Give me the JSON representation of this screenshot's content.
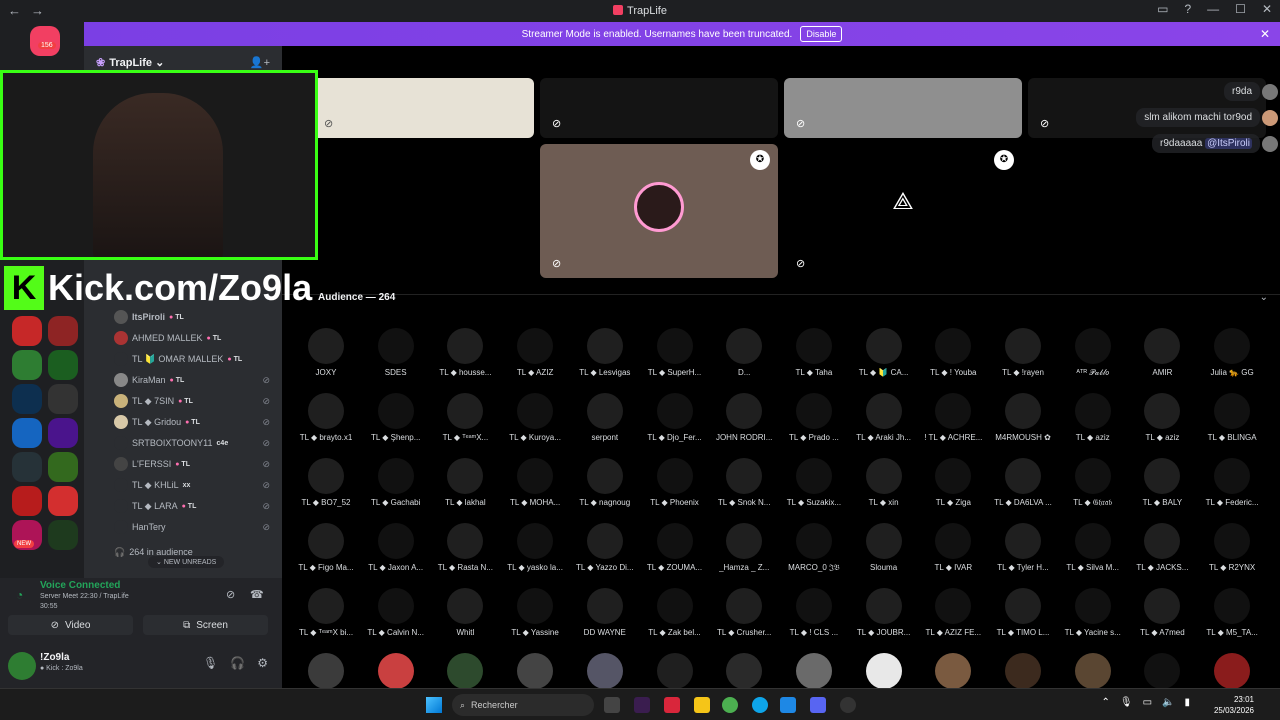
{
  "window": {
    "title": "TrapLife",
    "back_icon": "←",
    "forward_icon": "→",
    "controls": [
      "▭",
      "?",
      "—",
      "☐",
      "✕"
    ]
  },
  "banner": {
    "text": "Streamer Mode is enabled. Usernames have been truncated.",
    "disable_label": "Disable",
    "close_icon": "✕"
  },
  "servers": {
    "top_badge": "156",
    "new_badge": "NEW"
  },
  "guild": {
    "name": "TrapLife",
    "chevron": "⌄",
    "add_member_icon": "👤+"
  },
  "stage_users": [
    {
      "name": "ItsPiroli",
      "tag": "TL"
    },
    {
      "name": "AHMED MALLEK",
      "tag": "TL"
    },
    {
      "name": "TL 🔰 OMAR MALLEK",
      "tag": "TL"
    },
    {
      "name": "KiraMan",
      "tag": "TL"
    },
    {
      "name": "TL ◆ 7SIN",
      "tag": "TL"
    },
    {
      "name": "TL ◆ Gridou",
      "tag": "TL"
    },
    {
      "name": "SRTBOIXTOONY11",
      "tag": "c4e"
    },
    {
      "name": "L'FERSSI",
      "tag": "TL"
    },
    {
      "name": "TL ◆ KHLiL",
      "tag": "xx"
    },
    {
      "name": "TL ◆ LARA",
      "tag": "TL"
    },
    {
      "name": "HanTery",
      "tag": ""
    },
    {
      "name": "264 in audience",
      "tag": ""
    }
  ],
  "new_unreads": "NEW UNREADS",
  "voice": {
    "status": "Voice Connected",
    "channel": "Server Meet 22:30 / TrapLife",
    "timer": "30:55",
    "video_label": "Video",
    "screen_label": "Screen"
  },
  "user": {
    "name": "!Zo9la",
    "subtitle": "● Kick : Zo9la"
  },
  "chat": [
    {
      "text": "r9da"
    },
    {
      "text": "slm alikom machi tor9od"
    },
    {
      "text": "r9daaaaa",
      "mention": "@ItsPiroli"
    }
  ],
  "audience": {
    "title": "Audience — 264",
    "members": [
      "JOXY",
      "SDES",
      "TL ◆ housse...",
      "TL ◆ AZIZ",
      "TL ◆ Lesvigas",
      "TL ◆ SuperH...",
      "D...",
      "TL ◆ Taha",
      "TL ◆ 🔰 CA...",
      "TL ◆ ! Youba",
      "TL ◆ !rayen",
      "ᴬᵀᴿ 𝒫𝒶𝒷𝓁𝑜",
      "AMIR",
      "Julia 🐆 GG",
      "TL ◆ brayto.x1",
      "TL ◆ Şhenp...",
      "TL ◆ ᵀᵉᵃᵐX...",
      "TL ◆ Kuroya...",
      "serpont",
      "TL ◆ Djo_Fer...",
      "JOHN RODRI...",
      "TL ◆ Prado ...",
      "TL ◆ Araki Jh...",
      "! TL ◆ ACHRE...",
      "M4RMOUSH ✿",
      "TL ◆ aziz",
      "TL ◆ aziz",
      "TL ◆ BLINGA",
      "TL ◆ BO7_52",
      "TL ◆ Gachabi",
      "TL ◆ lakhal",
      "TL ◆ MOHA...",
      "TL ◆ nagnoug",
      "TL ◆ Phoenix",
      "TL ◆ Snok N...",
      "TL ◆ Suzakix...",
      "TL ◆ xin",
      "TL ◆ Ziga",
      "TL ◆ DA6LVA ...",
      "TL ◆ 𝔊𝔥𝔯𝔞𝔟",
      "TL ◆ BALY",
      "TL ◆ Federic...",
      "TL ◆ Figo Ma...",
      "TL ◆ Jaxon A...",
      "TL ◆ Rasta N...",
      "TL ◆ yasko la...",
      "TL ◆ Yazzo Di...",
      "TL ◆ ZOUMA...",
      "_Hamza _ Z...",
      "MARCO_0 𝔍𝔅",
      "Slouma",
      "TL ◆ IVAR",
      "TL ◆ Tyler H...",
      "TL ◆ Silva M...",
      "TL ◆ JACKS...",
      "TL ◆ R2YNX",
      "TL ◆ ᵀᵉᵃᵐX bi...",
      "TL ◆ Calvin N...",
      "Whitl",
      "TL ◆ Yassine",
      "DD WAYNE",
      "TL ◆ Zak bel...",
      "TL ◆ Crusher...",
      "TL ◆ ! CLS ...",
      "TL ◆ JOUBR...",
      "TL ◆ AZIZ FE...",
      "TL ◆ TIMO L...",
      "TL ◆ Yacine s...",
      "TL ◆ A7med",
      "TL ◆ M5_TA..."
    ]
  },
  "overlay": {
    "kick_letter": "K",
    "kick_text": "Kick.com/Zo9la"
  },
  "taskbar": {
    "search_placeholder": "Rechercher",
    "time": "23:01",
    "date": "25/03/2026"
  },
  "colors": {
    "accent": "#5865f2",
    "banner": "#8a45e8",
    "voice_green": "#23a55a",
    "kick_green": "#53fc18"
  }
}
